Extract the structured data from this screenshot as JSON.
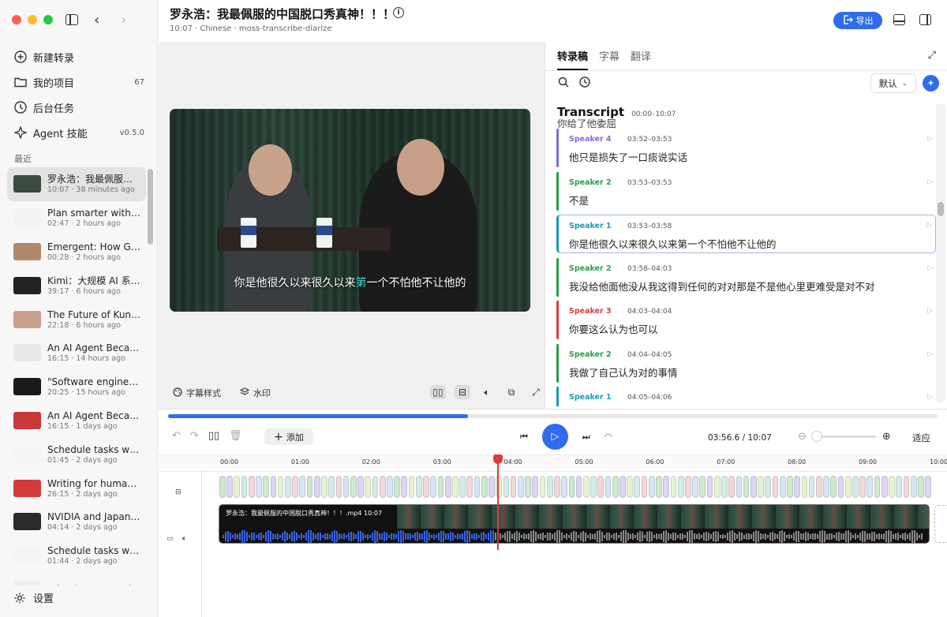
{
  "window": {
    "title": "罗永浩：我最佩服的中国脱口秀真神！！！",
    "subtitle": "10:07 · Chinese · moss-transcribe-diarize",
    "export_label": "导出"
  },
  "sidebar": {
    "menu": [
      {
        "label": "新建转录",
        "icon": "plus-circle-icon",
        "badge": ""
      },
      {
        "label": "我的项目",
        "icon": "folder-icon",
        "badge": "67"
      },
      {
        "label": "后台任务",
        "icon": "clock-icon",
        "badge": ""
      },
      {
        "label": "Agent 技能",
        "icon": "agent-icon",
        "badge": "v0.5.0"
      }
    ],
    "recent_title": "最近",
    "recent": [
      {
        "title": "罗永浩：我最佩服的中国脱口秀真神！！！",
        "meta": "10:07 · 38 minutes ago",
        "active": true,
        "thumb": "#3a4a40"
      },
      {
        "title": "Plan smarter with Claude",
        "meta": "02:47 · 2 hours ago",
        "active": false,
        "thumb": "#f3f3f3"
      },
      {
        "title": "Emergent: How Google DeepMind",
        "meta": "00:28 · 2 hours ago",
        "active": false,
        "thumb": "#b08a6a"
      },
      {
        "title": "Kimi：大规模 AI 系统实战",
        "meta": "39:17 · 6 hours ago",
        "active": false,
        "thumb": "#222222"
      },
      {
        "title": "The Future of Kung Fu AI",
        "meta": "22:18 · 6 hours ago",
        "active": false,
        "thumb": "#c9a08b"
      },
      {
        "title": "An AI Agent Became the CEO",
        "meta": "16:15 · 14 hours ago",
        "active": false,
        "thumb": "#e9e9e9"
      },
      {
        "title": "\"Software engineering is changing\"",
        "meta": "20:25 · 15 hours ago",
        "active": false,
        "thumb": "#1a1a1a"
      },
      {
        "title": "An AI Agent Became the CEO",
        "meta": "16:15 · 1 days ago",
        "active": false,
        "thumb": "#c83a3a"
      },
      {
        "title": "Schedule tasks with Claude",
        "meta": "01:45 · 2 days ago",
        "active": false,
        "thumb": "#f5f5f5"
      },
      {
        "title": "Writing for humans in the age of AI",
        "meta": "26:15 · 2 days ago",
        "active": false,
        "thumb": "#d23b3b"
      },
      {
        "title": "NVIDIA and Japan: Building AI",
        "meta": "04:14 · 2 days ago",
        "active": false,
        "thumb": "#2a2a2a"
      },
      {
        "title": "Schedule tasks with Claude",
        "meta": "01:44 · 2 days ago",
        "active": false,
        "thumb": "#f5f5f5"
      },
      {
        "title": "What is an Agentic Harness",
        "meta": "",
        "active": false,
        "thumb": "#eeeeee"
      }
    ],
    "settings_label": "设置"
  },
  "video": {
    "caption_before": "你是他很久以来很久以来",
    "caption_highlight": "第",
    "caption_after": "一个不怕他不让他的",
    "toolbar": {
      "subtitle_style": "字幕样式",
      "watermark": "水印"
    }
  },
  "transcript": {
    "tabs": [
      {
        "label": "转录稿",
        "active": true
      },
      {
        "label": "字幕",
        "active": false
      },
      {
        "label": "翻译",
        "active": false
      }
    ],
    "sort_label": "默认",
    "heading": "Transcript",
    "range": "00:00–10:07",
    "partial_text": "你给了他委屈",
    "segments": [
      {
        "speaker": "Speaker 4",
        "color": "#7b6fd6",
        "time": "03:52–03:53",
        "text": "他只是损失了一口痰说实话",
        "active": false
      },
      {
        "speaker": "Speaker 2",
        "color": "#2e9a4f",
        "time": "03:53–03:53",
        "text": "不是",
        "active": false
      },
      {
        "speaker": "Speaker 1",
        "color": "#1a9bb0",
        "time": "03:53–03:58",
        "text": "你是他很久以来很久以来第一个不怕他不让他的",
        "active": true
      },
      {
        "speaker": "Speaker 2",
        "color": "#2e9a4f",
        "time": "03:58–04:03",
        "text": "我没给他面他没从我这得到任何的对对那是不是他心里更难受是对不对",
        "active": false
      },
      {
        "speaker": "Speaker 3",
        "color": "#d14343",
        "time": "04:03–04:04",
        "text": "你要这么认为也可以",
        "active": false
      },
      {
        "speaker": "Speaker 2",
        "color": "#2e9a4f",
        "time": "04:04–04:05",
        "text": "我做了自己认为对的事情",
        "active": false
      },
      {
        "speaker": "Speaker 1",
        "color": "#1a9bb0",
        "time": "04:05–04:06",
        "text": "",
        "active": false
      }
    ]
  },
  "timeline": {
    "add_label": "添加",
    "current_time": "03:56.6",
    "total_time": "10:07",
    "fit_label": "适应",
    "progress_fraction": 0.39,
    "ruler": [
      "00:00",
      "01:00",
      "02:00",
      "03:00",
      "04:00",
      "05:00",
      "06:00",
      "07:00",
      "08:00",
      "09:00",
      "10:00"
    ],
    "clip_label": "罗永浩：我最佩服的中国脱口秀真神！！！.mp4  10:07",
    "playhead_fraction": 0.39
  }
}
